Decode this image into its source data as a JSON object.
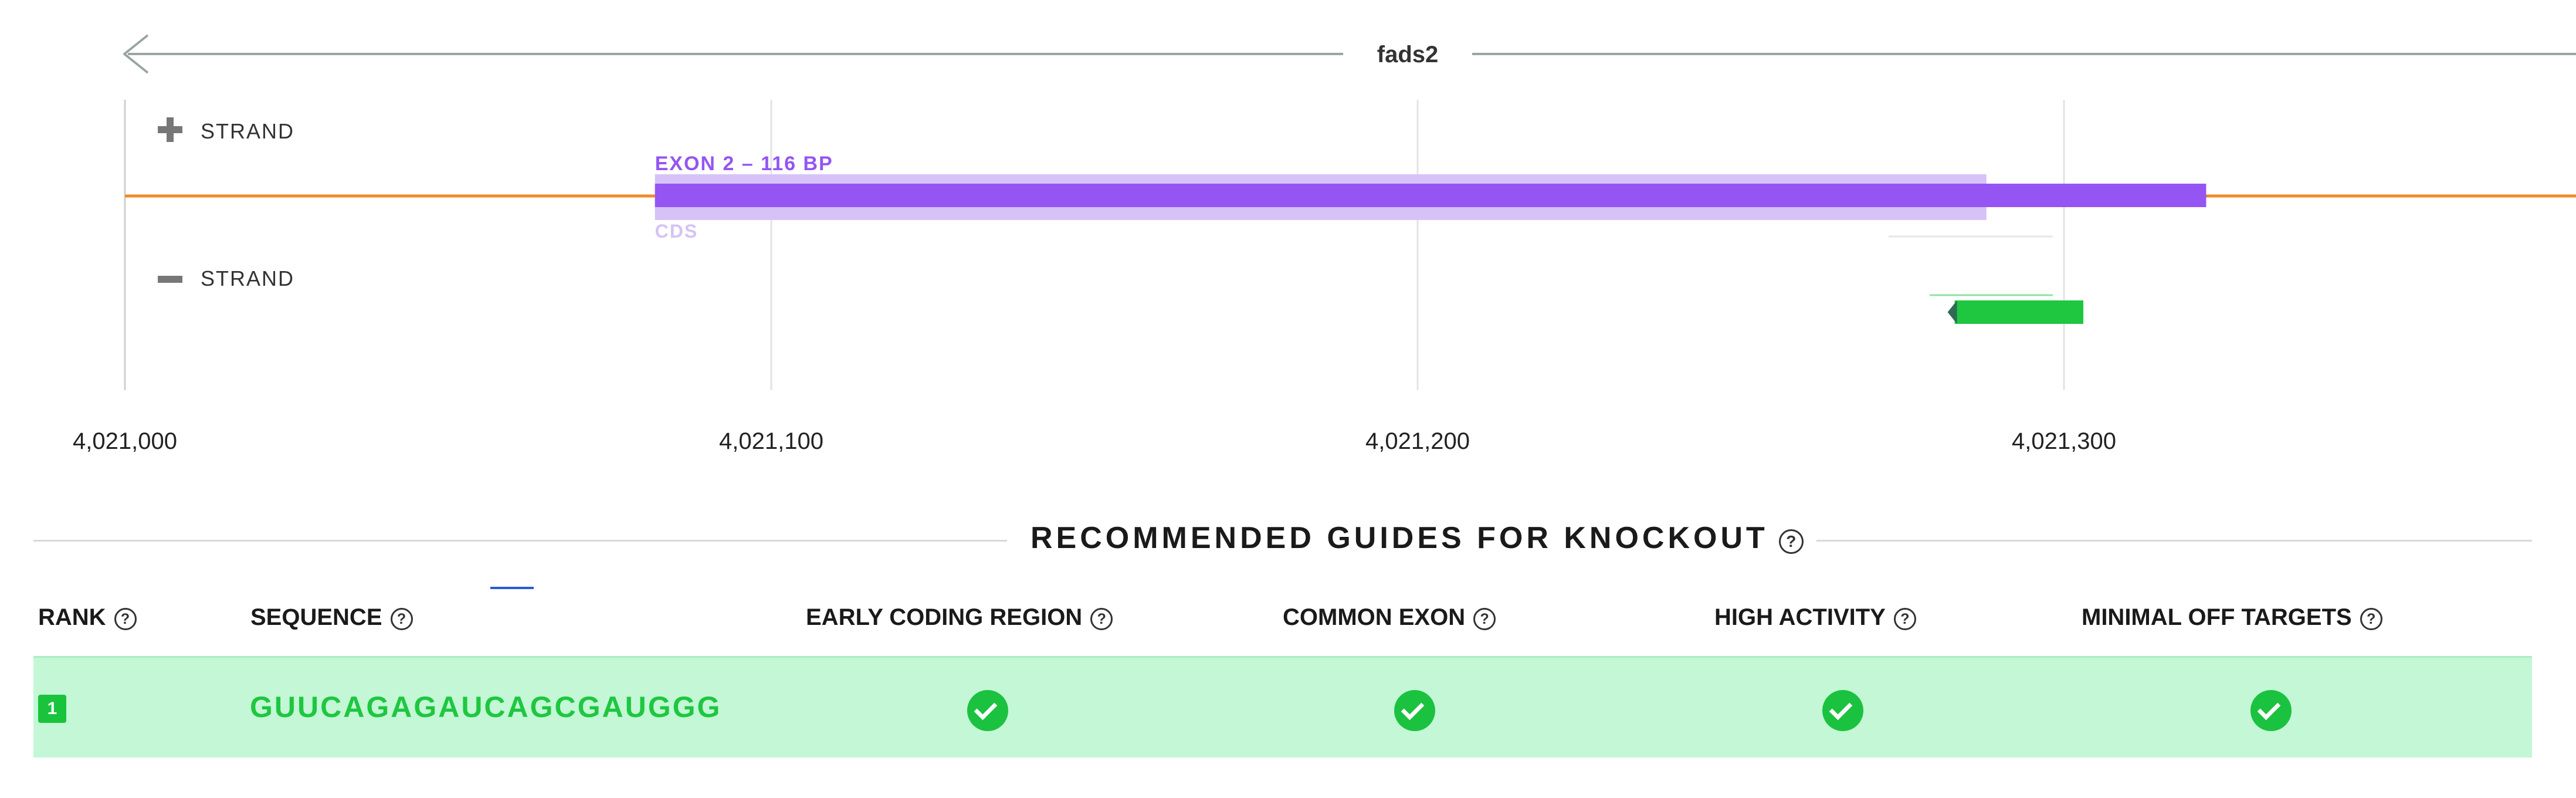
{
  "track": {
    "gene_name": "fads2",
    "plus_strand_label": "STRAND",
    "minus_strand_label": "STRAND",
    "plus_strand_icon": "plus-icon",
    "minus_strand_icon": "minus-icon",
    "exon_label": "EXON 2 – 116 BP",
    "cds_label": "CDS",
    "axis": {
      "min": 4021000,
      "max": 4021370,
      "ticks": [
        {
          "value": 4021000,
          "label": "4,021,000"
        },
        {
          "value": 4021100,
          "label": "4,021,100"
        },
        {
          "value": 4021200,
          "label": "4,021,200"
        },
        {
          "value": 4021300,
          "label": "4,021,300"
        }
      ]
    },
    "exon": {
      "start": 4021082,
      "end": 4021322
    },
    "cds": {
      "start": 4021082,
      "end": 4021288
    },
    "guide_marker": {
      "start": 4021282,
      "end": 4021303,
      "strand": "minus"
    },
    "colors": {
      "gene_line": "#f08a24",
      "exon": "#9455f3",
      "cds": "#d6c2f7",
      "guide": "#1ec73f",
      "axis_line": "#9aa5a0",
      "grid": "#e3e3e3"
    }
  },
  "guides_section": {
    "title": "RECOMMENDED GUIDES FOR KNOCKOUT",
    "columns": {
      "rank": "RANK",
      "sequence": "SEQUENCE",
      "early_coding_region": "EARLY CODING REGION",
      "common_exon": "COMMON EXON",
      "high_activity": "HIGH ACTIVITY",
      "minimal_off_targets": "MINIMAL OFF TARGETS"
    },
    "help_icon": "help-circle-icon",
    "rows": [
      {
        "rank": "1",
        "sequence": "GUUCAGAGAUCAGCGAUGGG",
        "early_coding_region": true,
        "common_exon": true,
        "high_activity": true,
        "minimal_off_targets": true
      }
    ],
    "colors": {
      "row_background": "#c3f7d6",
      "check": "#1bc23f",
      "sequence_text": "#1ec73f"
    }
  }
}
